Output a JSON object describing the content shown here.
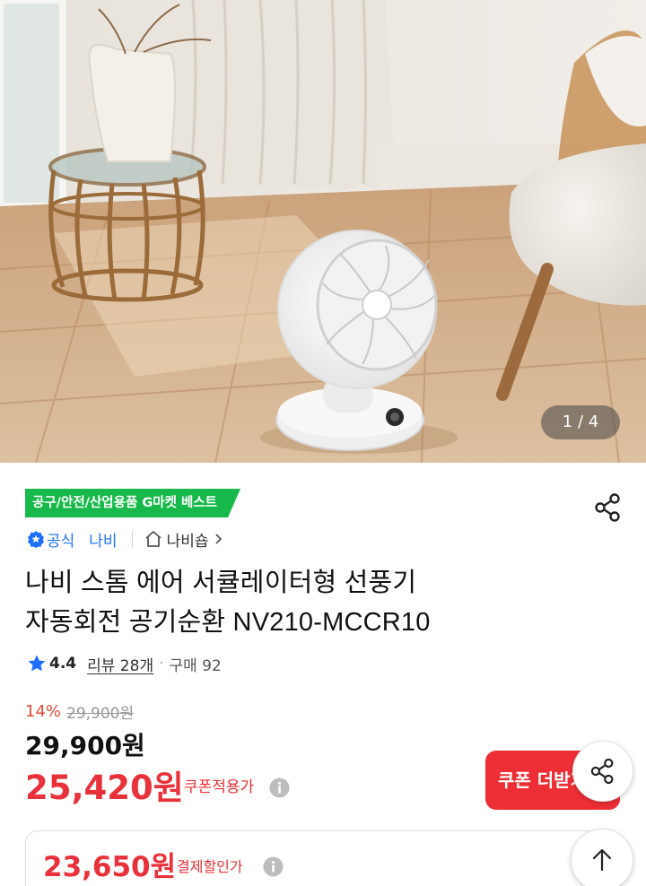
{
  "gallery": {
    "counter": "1 / 4"
  },
  "product": {
    "best_badge": "공구/안전/산업용품 G마켓 베스트",
    "official_label": "공식",
    "brand": "나비",
    "shop_name": "나비숍",
    "title_line1": "나비 스톰 에어 서큘레이터형 선풍기",
    "title_line2": "자동회전 공기순환 NV210-MCCR10",
    "rating": "4.4",
    "reviews": "리뷰 28개",
    "separator": "·",
    "purchase_count": "구매 92"
  },
  "pricing": {
    "discount_rate": "14%",
    "original_price": "29,900원",
    "price": "29,900원",
    "coupon_price": "25,420원",
    "coupon_label": "쿠폰적용가",
    "coupon_button": "쿠폰 더받기",
    "pay_price": "23,650원",
    "pay_label": "결제할인가"
  },
  "colors": {
    "accent_red": "#e8313a",
    "badge_green": "#17b94a",
    "link_blue": "#1f6fff"
  },
  "icons": [
    "share-icon",
    "official-badge-icon",
    "home-icon",
    "chevron-right-icon",
    "star-icon",
    "info-icon",
    "arrow-up-icon"
  ]
}
